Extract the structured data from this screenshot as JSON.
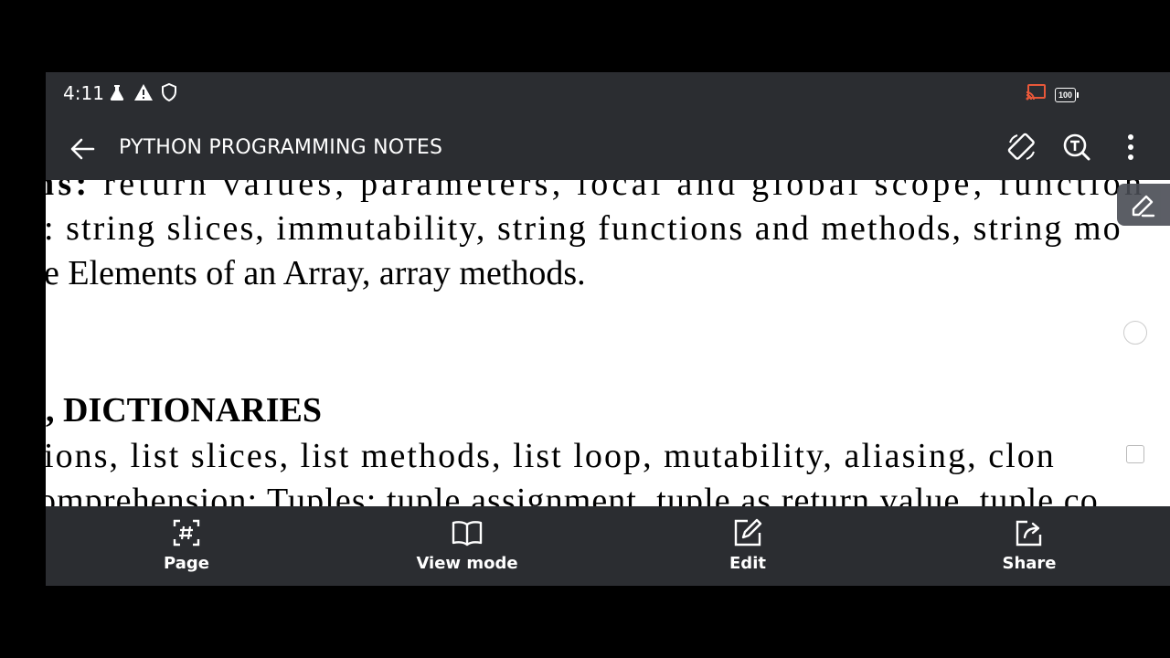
{
  "status_bar": {
    "time": "4:11",
    "left_icons": [
      "flask-icon",
      "warning-icon",
      "shield-icon"
    ],
    "battery": "100",
    "right_icons": [
      "cast-icon",
      "battery-icon"
    ]
  },
  "toolbar": {
    "title": "PYTHON PROGRAMMING NOTES",
    "actions": [
      "rotate-icon",
      "text-search-icon",
      "more-vert-icon"
    ]
  },
  "document": {
    "lines": [
      {
        "prefix": "ns:",
        "text": " return values, parameters, local and global scope, function"
      },
      {
        "text": ": string slices, immutability, string functions and methods, string mo"
      },
      {
        "text": "e Elements of an Array, array methods."
      },
      {
        "text": ", DICTIONARIES"
      },
      {
        "text": "ions, list slices, list methods, list loop, mutability, aliasing, clon"
      },
      {
        "text": "omprehension; Tuples: tuple assignment, tuple as return value, tuple co"
      }
    ]
  },
  "bottom_bar": {
    "items": [
      {
        "label": "Page",
        "icon": "page-grid-icon"
      },
      {
        "label": "View mode",
        "icon": "book-icon"
      },
      {
        "label": "Edit",
        "icon": "edit-icon"
      },
      {
        "label": "Share",
        "icon": "share-icon"
      }
    ]
  },
  "colors": {
    "bar_background": "#2b2d31",
    "page_background": "#ffffff",
    "cast_accent": "#e8583a"
  }
}
